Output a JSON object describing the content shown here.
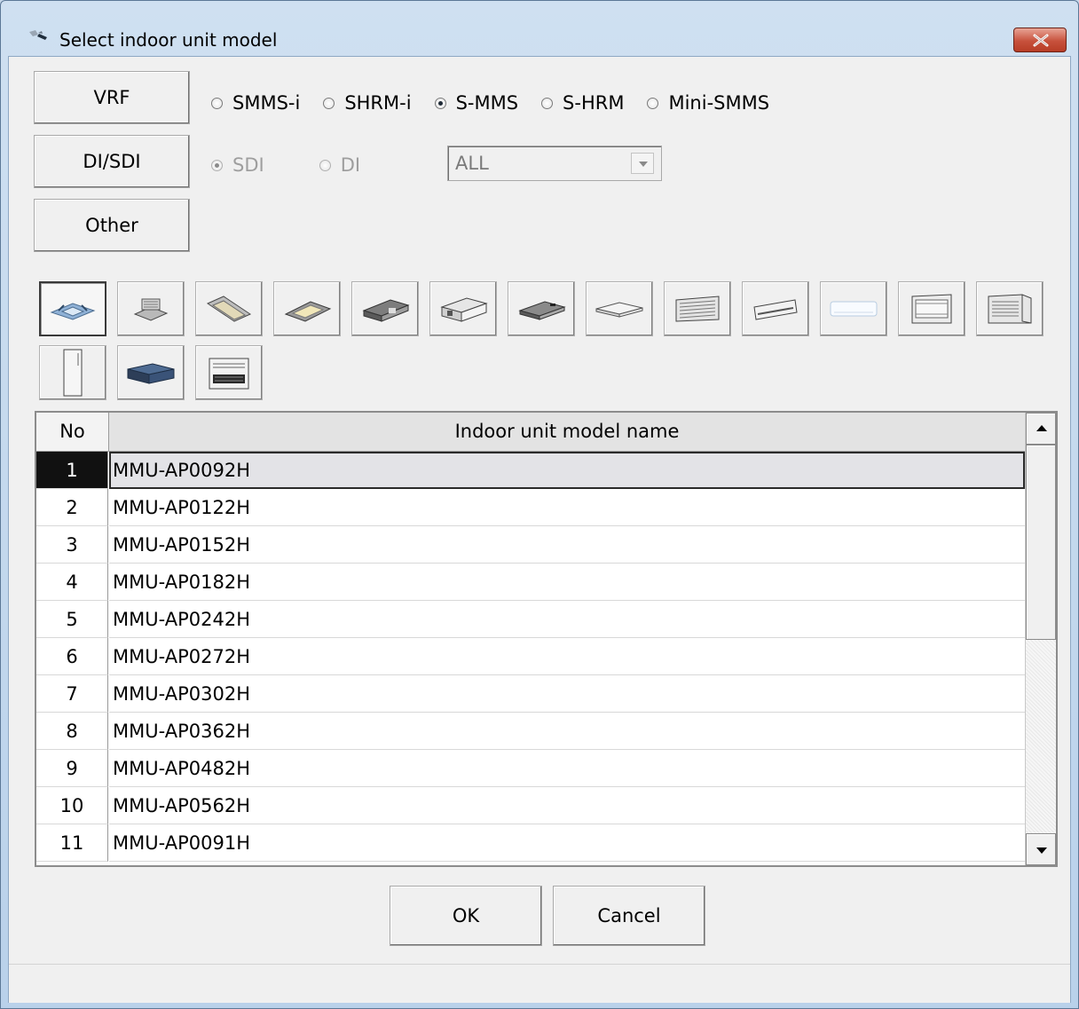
{
  "window": {
    "title": "Select indoor unit model",
    "close_icon": "close-icon"
  },
  "side_buttons": [
    {
      "label": "VRF"
    },
    {
      "label": "DI/SDI"
    },
    {
      "label": "Other"
    }
  ],
  "vrf_options": [
    {
      "label": "SMMS-i",
      "selected": false
    },
    {
      "label": "SHRM-i",
      "selected": false
    },
    {
      "label": "S-MMS",
      "selected": true
    },
    {
      "label": "S-HRM",
      "selected": false
    },
    {
      "label": "Mini-SMMS",
      "selected": false
    }
  ],
  "disi_options": [
    {
      "label": "SDI",
      "selected": true,
      "disabled": true
    },
    {
      "label": "DI",
      "selected": false,
      "disabled": true
    }
  ],
  "disi_filter": {
    "value": "ALL",
    "disabled": true
  },
  "unit_types": [
    {
      "name": "4-way-cassette-icon",
      "active": true
    },
    {
      "name": "compact-4-way-cassette-icon"
    },
    {
      "name": "2-way-cassette-icon"
    },
    {
      "name": "1-way-cassette-icon"
    },
    {
      "name": "concealed-duct-high-static-icon"
    },
    {
      "name": "concealed-duct-standard-icon"
    },
    {
      "name": "slim-duct-icon"
    },
    {
      "name": "ceiling-suspended-icon"
    },
    {
      "name": "high-wall-grille-icon"
    },
    {
      "name": "high-wall-icon"
    },
    {
      "name": "high-wall-compact-icon"
    },
    {
      "name": "floor-standing-cabinet-icon"
    },
    {
      "name": "floor-standing-concealed-icon"
    },
    {
      "name": "floor-standing-tall-icon"
    },
    {
      "name": "fresh-air-intake-icon"
    },
    {
      "name": "console-icon"
    }
  ],
  "table": {
    "headers": {
      "no": "No",
      "name": "Indoor unit model name"
    },
    "rows": [
      {
        "no": "1",
        "name": "MMU-AP0092H"
      },
      {
        "no": "2",
        "name": "MMU-AP0122H"
      },
      {
        "no": "3",
        "name": "MMU-AP0152H"
      },
      {
        "no": "4",
        "name": "MMU-AP0182H"
      },
      {
        "no": "5",
        "name": "MMU-AP0242H"
      },
      {
        "no": "6",
        "name": "MMU-AP0272H"
      },
      {
        "no": "7",
        "name": "MMU-AP0302H"
      },
      {
        "no": "8",
        "name": "MMU-AP0362H"
      },
      {
        "no": "9",
        "name": "MMU-AP0482H"
      },
      {
        "no": "10",
        "name": "MMU-AP0562H"
      },
      {
        "no": "11",
        "name": "MMU-AP0091H"
      }
    ],
    "selected_row": 0
  },
  "buttons": {
    "ok": "OK",
    "cancel": "Cancel"
  }
}
